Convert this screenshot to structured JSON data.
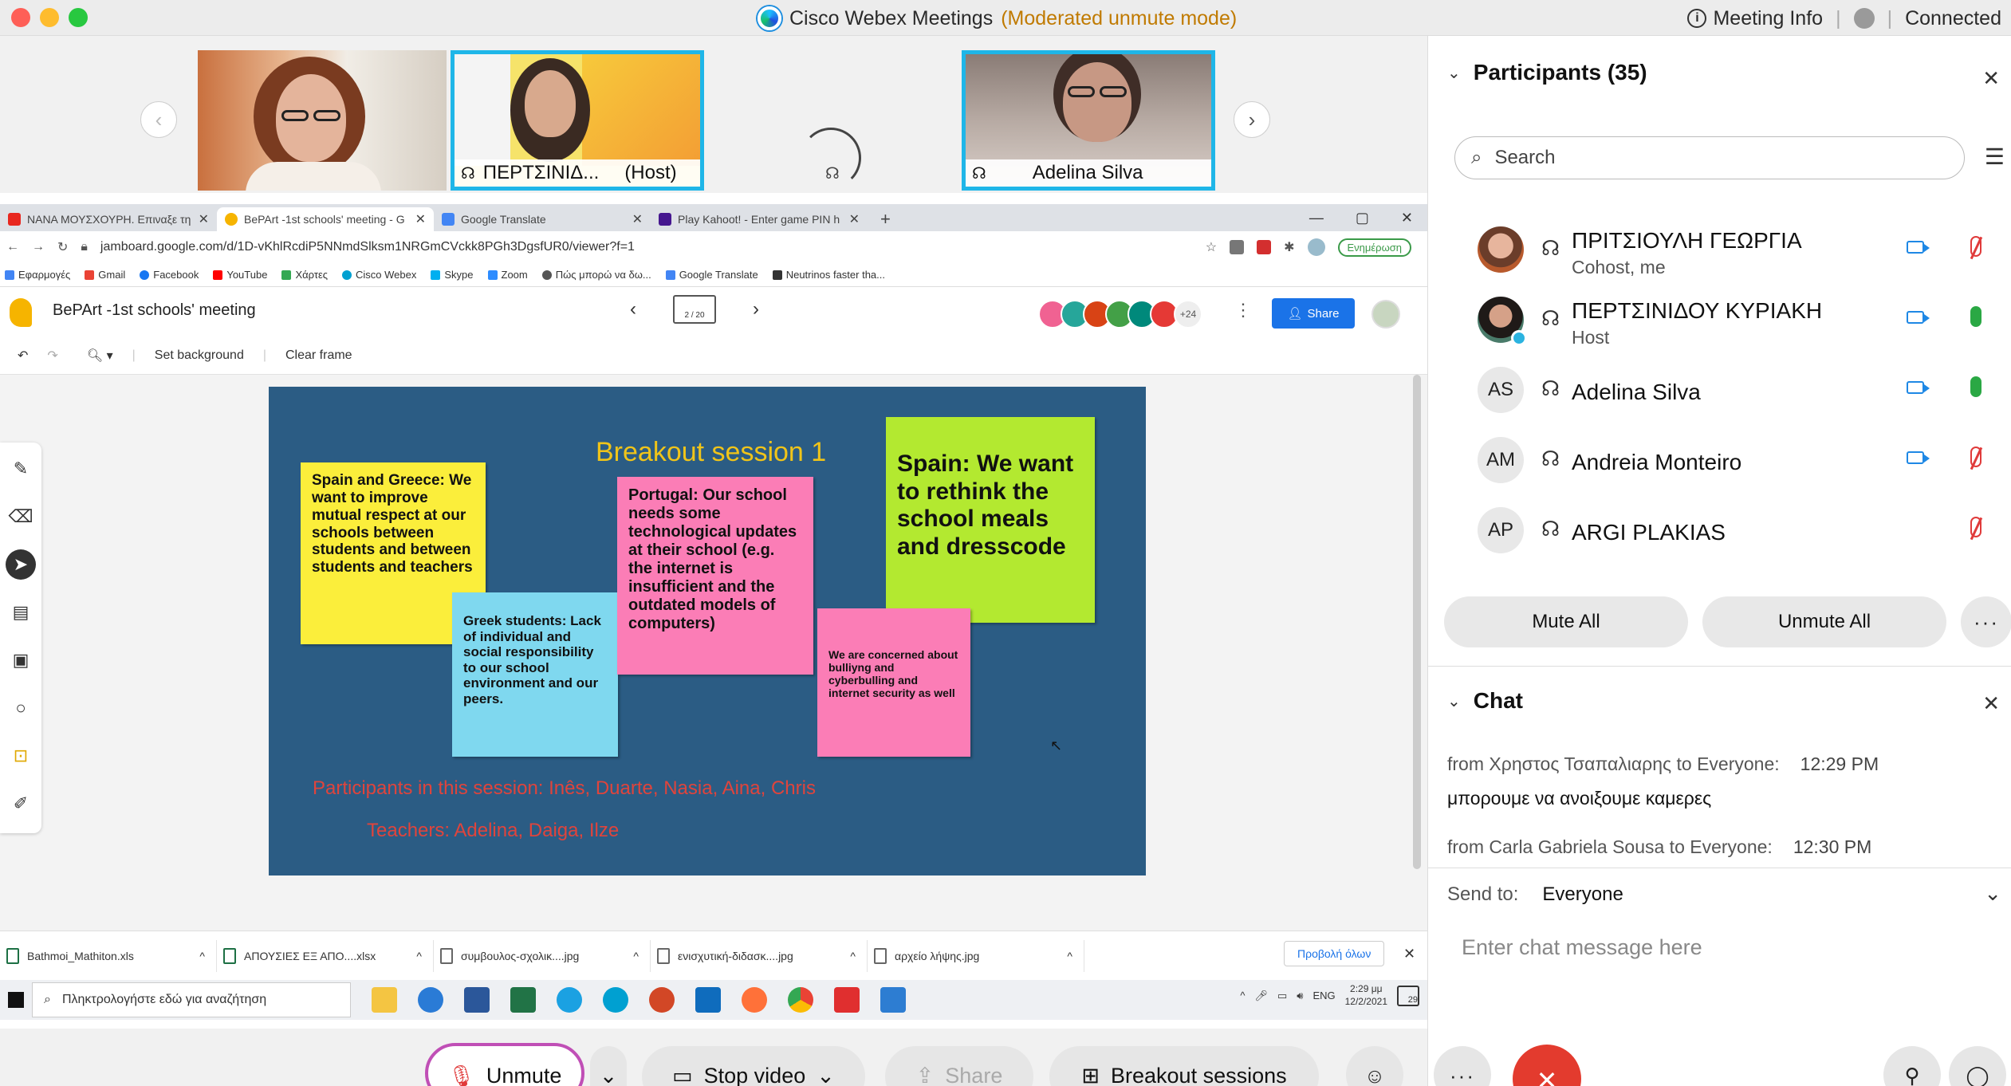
{
  "window": {
    "app_title": "Cisco Webex Meetings",
    "mode": "(Moderated unmute mode)",
    "meeting_info": "Meeting Info",
    "status": "Connected"
  },
  "video_strip": {
    "tiles": [
      {
        "label": ""
      },
      {
        "label": "ΠΕΡΤΣΙΝΙΔ...",
        "role": "(Host)"
      },
      {
        "label": ""
      },
      {
        "label": "Adelina Silva"
      }
    ]
  },
  "browser": {
    "tabs": [
      {
        "title": "NANA ΜΟΥΣΧΟΥΡΗ. Επιναξε τη",
        "favicon_color": "#e8271f"
      },
      {
        "title": "BePArt -1st schools' meeting - G",
        "favicon_color": "#f6b400"
      },
      {
        "title": "Google Translate",
        "favicon_color": "#4285f4"
      },
      {
        "title": "Play Kahoot! - Enter game PIN h",
        "favicon_color": "#46178f"
      }
    ],
    "url": "jamboard.google.com/d/1D-vKhlRcdiP5NNmdSlksm1NRGmCVckk8PGh3DgsfUR0/viewer?f=1",
    "update_label": "Ενημέρωση",
    "bookmarks": [
      "Εφαρμογές",
      "Gmail",
      "Facebook",
      "YouTube",
      "Χάρτες",
      "Cisco Webex",
      "Skype",
      "Zoom",
      "Πώς μπορώ να δω...",
      "Google Translate",
      "Neutrinos faster tha..."
    ]
  },
  "jamboard": {
    "title": "BePArt -1st schools' meeting",
    "frame_counter": "2 / 20",
    "avatars_more": "+24",
    "share_label": "Share",
    "toolbar": {
      "set_background": "Set background",
      "clear_frame": "Clear frame"
    },
    "frame": {
      "title": "Breakout session 1",
      "notes": [
        {
          "text": "Spain and Greece: We want to improve mutual respect at our schools between students and between students and teachers",
          "color": "#fbee3b"
        },
        {
          "text": "Greek students: Lack of individual and social responsibility to our school environment and our peers.",
          "color": "#7fd8ef"
        },
        {
          "text": "Portugal: Our school needs some technological updates at their school (e.g. the internet is insufficient and the outdated models of computers)",
          "color": "#fb7db6"
        },
        {
          "text": "Spain: We want to rethink the school meals and dresscode",
          "color": "#b3e930"
        },
        {
          "text": "We are concerned about bulliyng and cyberbulling and internet security as well",
          "color": "#fb7db6"
        }
      ],
      "participants_line": "Participants in this session: Inês, Duarte, Nasia, Aina, Chris",
      "teachers_line": "Teachers: Adelina, Daiga, Ilze"
    }
  },
  "downloads": {
    "items": [
      "Bathmoi_Mathiton.xls",
      "ΑΠΟΥΣΙΕΣ ΕΞ ΑΠΟ....xlsx",
      "συμβουλος-σχολικ....jpg",
      "ενισχυτική-διδασκ....jpg",
      "αρχείο λήψης.jpg"
    ],
    "show_all": "Προβολή όλων"
  },
  "taskbar": {
    "search_placeholder": "Πληκτρολογήστε εδώ για αναζήτηση",
    "lang": "ENG",
    "time": "2:29 μμ",
    "date": "12/2/2021",
    "notif_count": "29"
  },
  "participants": {
    "header": "Participants (35)",
    "search_placeholder": "Search",
    "list": [
      {
        "name": "ΠΡΙΤΣΙΟΥΛΗ ΓΕΩΡΓΙΑ",
        "role": "Cohost, me",
        "initials": "",
        "video": true,
        "mic": "off"
      },
      {
        "name": "ΠΕΡΤΣΙΝΙΔΟΥ ΚΥΡΙΑΚΗ",
        "role": "Host",
        "initials": "",
        "video": true,
        "mic": "on"
      },
      {
        "name": "Adelina Silva",
        "role": "",
        "initials": "AS",
        "video": true,
        "mic": "on"
      },
      {
        "name": "Andreia Monteiro",
        "role": "",
        "initials": "AM",
        "video": true,
        "mic": "off"
      },
      {
        "name": "ARGI PLAKIAS",
        "role": "",
        "initials": "AP",
        "video": false,
        "mic": "off"
      }
    ],
    "mute_all": "Mute All",
    "unmute_all": "Unmute All"
  },
  "chat": {
    "header": "Chat",
    "messages": [
      {
        "from": "from Χρηστος Τσαπαλιαρης to Everyone:",
        "time": "12:29  PM",
        "text": "μπορουμε να ανοιξουμε καμερες"
      },
      {
        "from": "from Carla Gabriela Sousa to Everyone:",
        "time": "12:30  PM",
        "text": ""
      }
    ],
    "send_to_label": "Send to:",
    "send_to_value": "Everyone",
    "input_placeholder": "Enter chat message here"
  },
  "controls": {
    "unmute": "Unmute",
    "stop_video": "Stop video",
    "share": "Share",
    "breakout": "Breakout sessions"
  },
  "colors": {
    "accent": "#1fb6e8",
    "end": "#e33b2e",
    "mode": "#c07a00",
    "host_frame": "#2b5c84"
  }
}
